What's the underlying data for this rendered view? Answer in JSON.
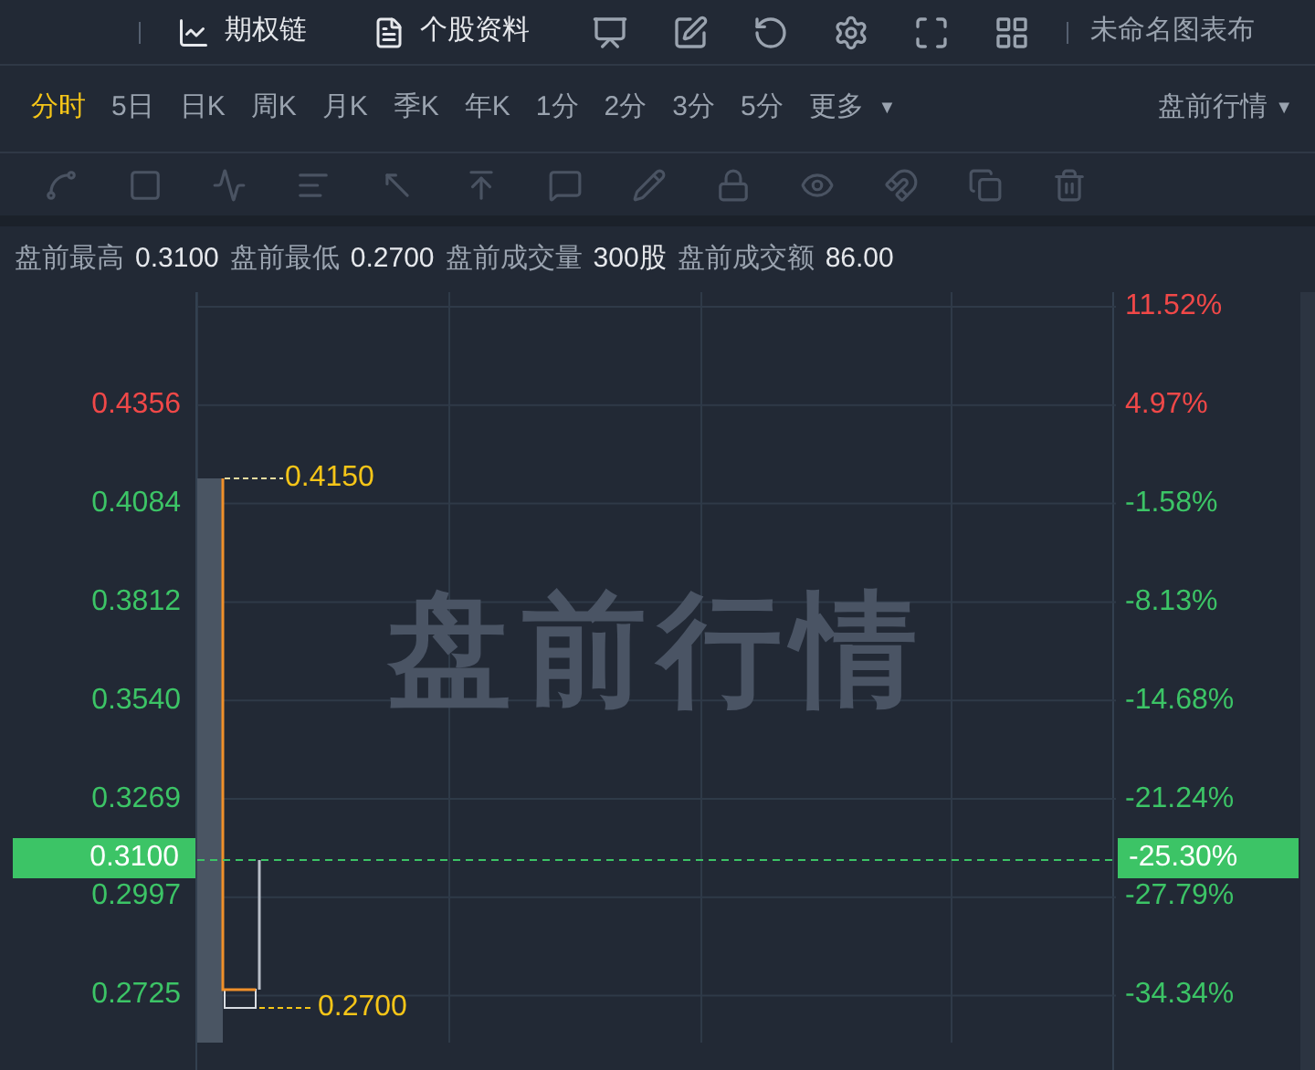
{
  "toolbar": {
    "buttons": [
      {
        "label": "期权链"
      },
      {
        "label": "个股资料"
      }
    ],
    "layout_name": "未命名图表布"
  },
  "periods": [
    {
      "label": "分时",
      "selected": true
    },
    {
      "label": "5日",
      "selected": false
    },
    {
      "label": "日K",
      "selected": false
    },
    {
      "label": "周K",
      "selected": false
    },
    {
      "label": "月K",
      "selected": false
    },
    {
      "label": "季K",
      "selected": false
    },
    {
      "label": "年K",
      "selected": false
    },
    {
      "label": "1分",
      "selected": false
    },
    {
      "label": "2分",
      "selected": false
    },
    {
      "label": "3分",
      "selected": false
    },
    {
      "label": "5分",
      "selected": false
    }
  ],
  "more": {
    "label": "更多",
    "caret": "▼"
  },
  "session": {
    "label": "盘前行情",
    "caret": "▼"
  },
  "stats": [
    {
      "label": "盘前最高",
      "value": "0.3100"
    },
    {
      "label": "盘前最低",
      "value": "0.2700"
    },
    {
      "label": "盘前成交量",
      "value": "300股"
    },
    {
      "label": "盘前成交额",
      "value": "86.00"
    }
  ],
  "chart": {
    "watermark": "盘前行情",
    "current": {
      "label": "0.3100",
      "percent": "-25.30%"
    },
    "high_label": "0.4150",
    "low_label": "0.2700",
    "price_ticks": [
      {
        "label": "0.4356",
        "rising": true
      },
      {
        "label": "0.4084",
        "rising": false
      },
      {
        "label": "0.3812",
        "rising": false
      },
      {
        "label": "0.3540",
        "rising": false
      },
      {
        "label": "0.3269",
        "rising": false
      },
      {
        "label": "0.2997",
        "rising": false
      },
      {
        "label": "0.2725",
        "rising": false
      }
    ],
    "percent_ticks": [
      {
        "label": "11.52%",
        "rising": true
      },
      {
        "label": "4.97%",
        "rising": true
      },
      {
        "label": "-1.58%",
        "rising": false
      },
      {
        "label": "-8.13%",
        "rising": false
      },
      {
        "label": "-14.68%",
        "rising": false
      },
      {
        "label": "-21.24%",
        "rising": false
      },
      {
        "label": "-27.79%",
        "rising": false
      },
      {
        "label": "-34.34%",
        "rising": false
      }
    ]
  }
}
